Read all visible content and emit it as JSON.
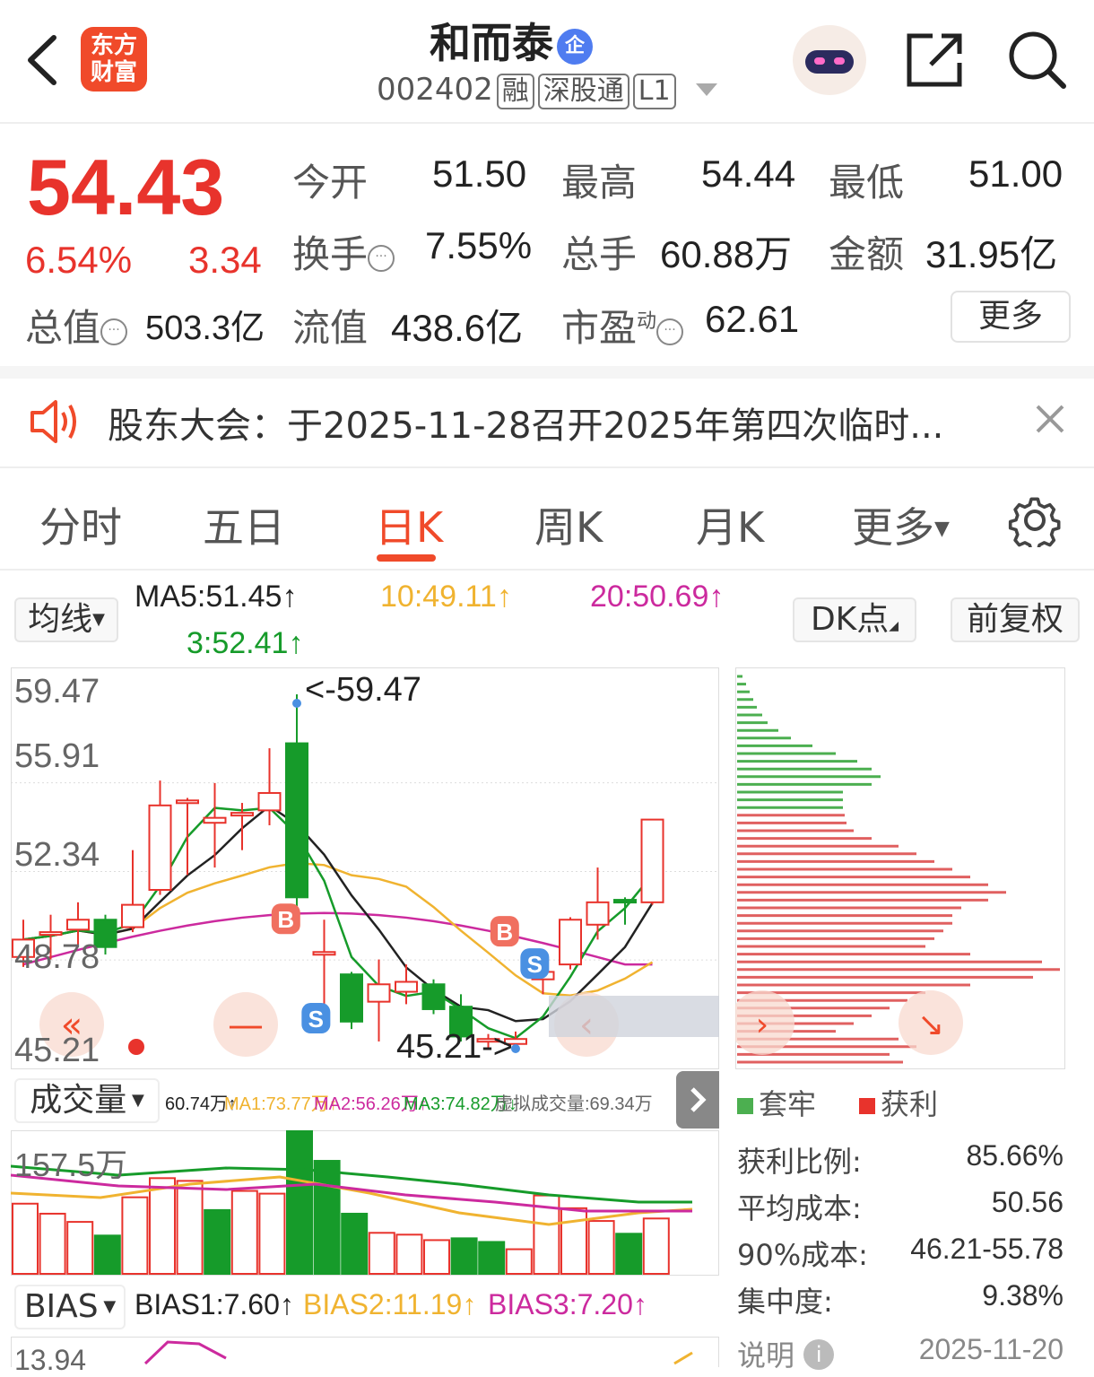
{
  "header": {
    "logo_line1": "东方",
    "logo_line2": "财富",
    "stock_name": "和而泰",
    "qi_badge": "企",
    "code": "002402",
    "tag_rong": "融",
    "tag_sgt": "深股通",
    "tag_l1": "L1"
  },
  "quote": {
    "price": "54.43",
    "change_pct": "6.54%",
    "change_amt": "3.34",
    "open_label": "今开",
    "open": "51.50",
    "high_label": "最高",
    "high": "54.44",
    "low_label": "最低",
    "low": "51.00",
    "turnover_label": "换手",
    "turnover": "7.55%",
    "volume_label": "总手",
    "volume": "60.88万",
    "amount_label": "金额",
    "amount": "31.95亿",
    "mktcap_label": "总值",
    "mktcap": "503.3亿",
    "float_label": "流值",
    "float": "438.6亿",
    "pe_label": "市盈",
    "pe_sup": "动",
    "pe": "62.61",
    "more_label": "更多"
  },
  "notice": {
    "text": "股东大会：于2025-11-28召开2025年第四次临时..."
  },
  "tabs": [
    "分时",
    "五日",
    "日K",
    "周K",
    "月K",
    "更多"
  ],
  "kline": {
    "ma_selector": "均线",
    "ma5": "MA5:51.45↑",
    "ma10": "10:49.11↑",
    "ma20": "20:50.69↑",
    "ma3": "3:52.41↑",
    "dk_label": "DK点",
    "adjust_label": "前复权",
    "y_labels": [
      "59.47",
      "55.91",
      "52.34",
      "48.78",
      "45.21"
    ],
    "max_label": "<-59.47",
    "min_label": "45.21->",
    "b_marker": "B",
    "s_marker": "S"
  },
  "volume": {
    "selector": "成交量",
    "vol": "60.74万↑",
    "ma1": "MA1:73.77万↑",
    "ma2": "MA2:56.26万↑",
    "ma3": "MA3:74.82万↓",
    "virtual": "虚拟成交量:69.34万",
    "max_label": "157.5万"
  },
  "bias": {
    "selector": "BIAS",
    "b1": "BIAS1:7.60↑",
    "b2": "BIAS2:11.19↑",
    "b3": "BIAS3:7.20↑",
    "top_label": "13.94"
  },
  "chips": {
    "legend_trapped": "套牢",
    "legend_profit": "获利",
    "profit_ratio_label": "获利比例:",
    "profit_ratio": "85.66%",
    "avg_cost_label": "平均成本:",
    "avg_cost": "50.56",
    "cost90_label": "90%成本:",
    "cost90": "46.21-55.78",
    "concentration_label": "集中度:",
    "concentration": "9.38%",
    "note_label": "说明",
    "date": "2025-11-20"
  },
  "colors": {
    "up": "#e8332c",
    "down": "#169b2a",
    "accent": "#f04a2a"
  },
  "chart_data": {
    "type": "candlestick",
    "ylim": [
      45.21,
      59.47
    ],
    "candles": [
      {
        "o": 48.9,
        "c": 49.6,
        "h": 50.4,
        "l": 48.5
      },
      {
        "o": 49.9,
        "c": 49.9,
        "h": 50.6,
        "l": 48.8
      },
      {
        "o": 50.0,
        "c": 50.4,
        "h": 51.1,
        "l": 49.3
      },
      {
        "o": 50.4,
        "c": 49.3,
        "h": 50.6,
        "l": 49.0
      },
      {
        "o": 50.1,
        "c": 51.0,
        "h": 53.2,
        "l": 49.9
      },
      {
        "o": 51.6,
        "c": 55.0,
        "h": 56.0,
        "l": 51.4
      },
      {
        "o": 55.2,
        "c": 55.2,
        "h": 55.3,
        "l": 52.2
      },
      {
        "o": 54.3,
        "c": 54.5,
        "h": 55.9,
        "l": 52.5
      },
      {
        "o": 54.7,
        "c": 54.7,
        "h": 55.1,
        "l": 53.2
      },
      {
        "o": 54.8,
        "c": 55.5,
        "h": 57.3,
        "l": 54.2
      },
      {
        "o": 57.5,
        "c": 51.3,
        "h": 59.47,
        "l": 50.6
      },
      {
        "o": 49.1,
        "c": 49.1,
        "h": 50.4,
        "l": 46.4
      },
      {
        "o": 48.2,
        "c": 46.3,
        "h": 48.3,
        "l": 46.0
      },
      {
        "o": 47.1,
        "c": 47.8,
        "h": 48.8,
        "l": 45.5
      },
      {
        "o": 47.5,
        "c": 47.9,
        "h": 48.6,
        "l": 47.0
      },
      {
        "o": 47.8,
        "c": 46.8,
        "h": 48.0,
        "l": 46.6
      },
      {
        "o": 46.9,
        "c": 45.7,
        "h": 47.4,
        "l": 45.5
      },
      {
        "o": 45.6,
        "c": 45.6,
        "h": 45.8,
        "l": 45.21
      },
      {
        "o": 45.4,
        "c": 45.6,
        "h": 45.9,
        "l": 45.2
      },
      {
        "o": 48.0,
        "c": 48.3,
        "h": 49.0,
        "l": 47.4
      },
      {
        "o": 48.6,
        "c": 50.4,
        "h": 50.5,
        "l": 48.4
      },
      {
        "o": 50.2,
        "c": 51.1,
        "h": 52.5,
        "l": 49.6
      },
      {
        "o": 51.2,
        "c": 51.1,
        "h": 51.3,
        "l": 50.2
      },
      {
        "o": 51.1,
        "c": 54.43,
        "h": 54.44,
        "l": 51.0
      }
    ],
    "volumes": [
      [
        77,
        "r"
      ],
      [
        66,
        "r"
      ],
      [
        57,
        "r"
      ],
      [
        42,
        "g"
      ],
      [
        84,
        "r"
      ],
      [
        105,
        "r"
      ],
      [
        102,
        "r"
      ],
      [
        70,
        "g"
      ],
      [
        91,
        "r"
      ],
      [
        88,
        "r"
      ],
      [
        157.5,
        "g"
      ],
      [
        124,
        "g"
      ],
      [
        66,
        "g"
      ],
      [
        45,
        "r"
      ],
      [
        43,
        "r"
      ],
      [
        37,
        "r"
      ],
      [
        39,
        "g"
      ],
      [
        35,
        "g"
      ],
      [
        27,
        "r"
      ],
      [
        86,
        "r"
      ],
      [
        72,
        "r"
      ],
      [
        58,
        "r"
      ],
      [
        44,
        "g"
      ],
      [
        60.74,
        "r"
      ]
    ]
  }
}
